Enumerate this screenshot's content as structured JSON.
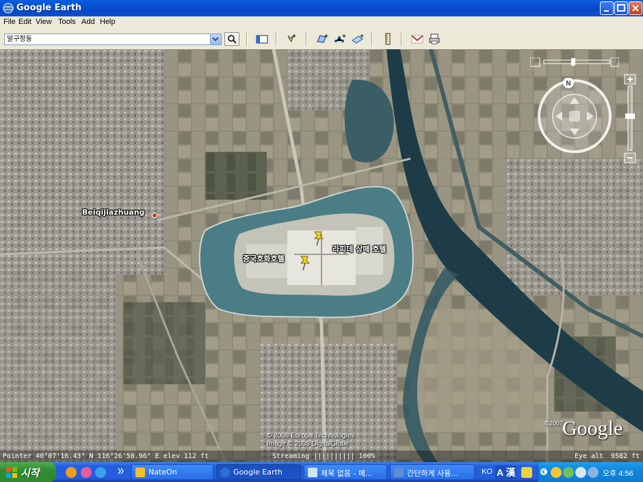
{
  "window": {
    "title": "Google Earth"
  },
  "menu": [
    "File",
    "Edit",
    "View",
    "Tools",
    "Add",
    "Help"
  ],
  "search": {
    "value": "알구정동"
  },
  "map": {
    "labels": {
      "town": "Beiqijiazhuang",
      "hotel1": "중국호화호텔",
      "hotel2": "라피데 상떼 호텔"
    },
    "compass": "N",
    "copyright": [
      "© 2008 Europa Technologies",
      "Image © 2008 DigitalGlobe"
    ],
    "logo": {
      "year": "©2007",
      "text": "Google"
    }
  },
  "statusbar": {
    "pointer": "Pointer  40°07'16.43\" N  116°26'50.96\" E   elev   112 ft",
    "streaming": "Streaming |||||||||| 100%",
    "eye_alt": "Eye alt",
    "eye_alt_value": "9582 ft"
  },
  "taskbar": {
    "start": "시작",
    "tasks": [
      {
        "label": "NateOn"
      },
      {
        "label": "Google Earth"
      },
      {
        "label": "제목 없음 - 메..."
      },
      {
        "label": "간단하게 사용..."
      }
    ],
    "lang": "KO",
    "ime": "A 漢",
    "clock": "오후 4:56"
  },
  "colors": {
    "title_blue": "#0548c7",
    "taskbar_blue": "#245edc",
    "start_green": "#318c31",
    "moat": "#4a7d86",
    "river": "#1d3c48"
  }
}
